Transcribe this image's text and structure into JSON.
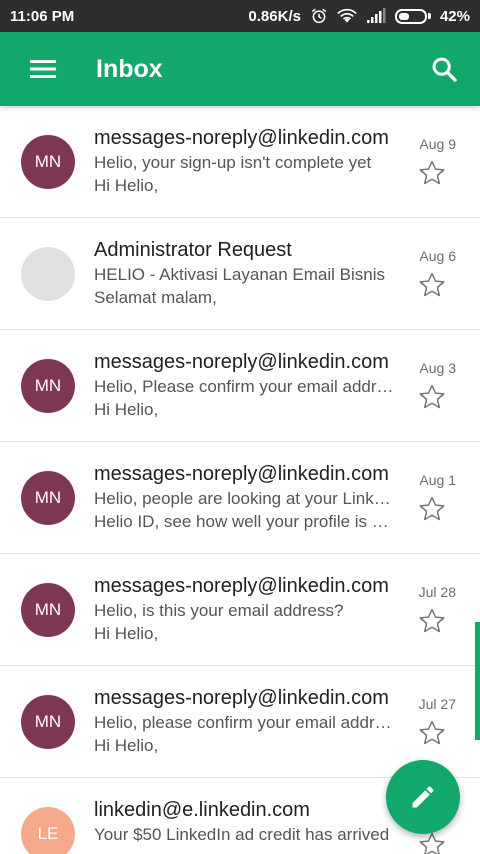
{
  "status_bar": {
    "time": "11:06 PM",
    "speed": "0.86K/s",
    "battery": "42%",
    "battery_level": 0.42,
    "icons": [
      "alarm-icon",
      "wifi-icon",
      "signal-icon",
      "battery-icon"
    ]
  },
  "app_bar": {
    "title": "Inbox",
    "menu_icon": "menu-icon",
    "search_icon": "search-icon",
    "color": "#13a86b"
  },
  "emails": [
    {
      "initials": "MN",
      "avatar_color": "#7e3755",
      "sender": "messages-noreply@linkedin.com",
      "subject": "Helio, your sign-up isn't complete yet",
      "snippet": "Hi Helio,",
      "date": "Aug 9"
    },
    {
      "initials": "",
      "avatar_color": "#e0e0e0",
      "sender": "Administrator Request",
      "subject": "HELIO - Aktivasi Layanan Email Bisnis",
      "snippet": "Selamat malam,",
      "date": "Aug 6"
    },
    {
      "initials": "MN",
      "avatar_color": "#7e3755",
      "sender": "messages-noreply@linkedin.com",
      "subject": "Helio, Please confirm your email address",
      "snippet": "Hi Helio,",
      "date": "Aug 3"
    },
    {
      "initials": "MN",
      "avatar_color": "#7e3755",
      "sender": "messages-noreply@linkedin.com",
      "subject": "Helio, people are looking at your LinkedIn profile",
      "snippet": "Helio ID, see how well your profile is doing",
      "date": "Aug 1"
    },
    {
      "initials": "MN",
      "avatar_color": "#7e3755",
      "sender": "messages-noreply@linkedin.com",
      "subject": "Helio, is this your email address?",
      "snippet": "Hi Helio,",
      "date": "Jul 28"
    },
    {
      "initials": "MN",
      "avatar_color": "#7e3755",
      "sender": "messages-noreply@linkedin.com",
      "subject": "Helio, please confirm your email address",
      "snippet": "Hi Helio,",
      "date": "Jul 27"
    },
    {
      "initials": "LE",
      "avatar_color": "#f5a98a",
      "sender": "linkedin@e.linkedin.com",
      "subject": "Your $50 LinkedIn ad credit has arrived",
      "snippet": "",
      "date": ""
    }
  ],
  "fab": {
    "icon": "pencil-icon",
    "color": "#13a86b"
  }
}
